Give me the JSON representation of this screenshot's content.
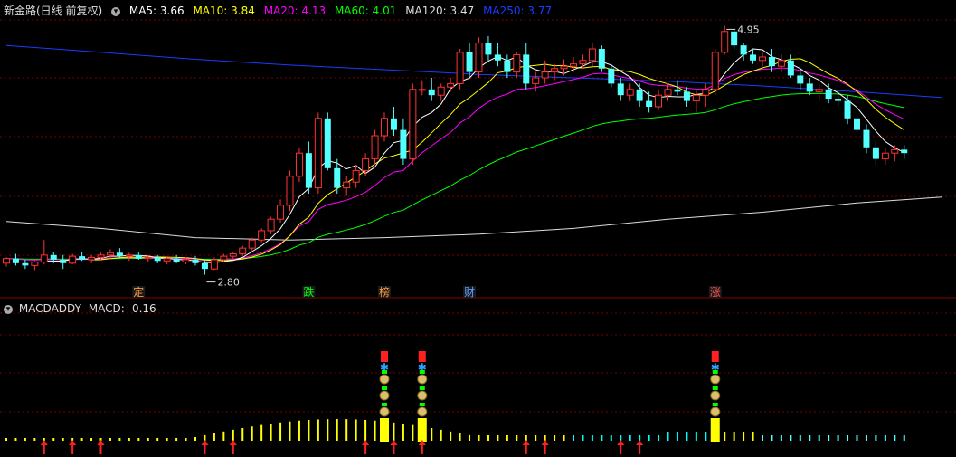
{
  "header": {
    "title": "新金路(日线 前复权)",
    "ma": [
      {
        "label": "MA5: 3.66",
        "color": "#ffffff"
      },
      {
        "label": "MA10: 3.84",
        "color": "#ffff00"
      },
      {
        "label": "MA20: 4.13",
        "color": "#ff00ff"
      },
      {
        "label": "MA60: 4.01",
        "color": "#00ff00"
      },
      {
        "label": "MA120: 3.47",
        "color": "#dddddd"
      },
      {
        "label": "MA250: 3.77",
        "color": "#1a3cff"
      }
    ]
  },
  "indicator": {
    "name": "MACDADDY",
    "value_label": "MACD: -0.16"
  },
  "colors": {
    "up": "#ff3232",
    "down": "#54ffff",
    "grid": "#7a0000",
    "ma5": "#ffffff",
    "ma10": "#ffff00",
    "ma20": "#ff00ff",
    "ma60": "#00ff00",
    "ma120": "#dddddd",
    "ma250": "#1a3cff"
  },
  "chart_data": [
    {
      "type": "candlestick",
      "title": "新金路(日线 前复权)",
      "annotations": [
        {
          "text": "4.95",
          "kind": "high",
          "index": 76
        },
        {
          "text": "2.80",
          "kind": "low",
          "index": 21
        }
      ],
      "event_markers": [
        {
          "text": "定",
          "index": 14,
          "color": "#ff9a3c"
        },
        {
          "text": "跌",
          "index": 32,
          "color": "#00ff00"
        },
        {
          "text": "榜",
          "index": 40,
          "color": "#ff9a3c"
        },
        {
          "text": "财",
          "index": 49,
          "color": "#5a9cff"
        },
        {
          "text": "涨",
          "index": 75,
          "color": "#ff5050"
        }
      ],
      "ohlc": [
        [
          2.9,
          2.95,
          2.87,
          2.94
        ],
        [
          2.94,
          2.98,
          2.88,
          2.9
        ],
        [
          2.9,
          2.93,
          2.85,
          2.88
        ],
        [
          2.88,
          2.92,
          2.84,
          2.91
        ],
        [
          2.91,
          3.1,
          2.89,
          2.97
        ],
        [
          2.97,
          3.0,
          2.9,
          2.93
        ],
        [
          2.93,
          2.97,
          2.85,
          2.9
        ],
        [
          2.9,
          2.98,
          2.89,
          2.96
        ],
        [
          2.96,
          3.0,
          2.92,
          2.93
        ],
        [
          2.93,
          2.97,
          2.9,
          2.95
        ],
        [
          2.95,
          2.99,
          2.93,
          2.97
        ],
        [
          2.97,
          3.02,
          2.94,
          2.99
        ],
        [
          2.99,
          3.03,
          2.95,
          2.96
        ],
        [
          2.96,
          2.99,
          2.92,
          2.97
        ],
        [
          2.97,
          3.0,
          2.93,
          2.94
        ],
        [
          2.94,
          2.97,
          2.91,
          2.95
        ],
        [
          2.95,
          2.97,
          2.9,
          2.92
        ],
        [
          2.92,
          2.96,
          2.89,
          2.94
        ],
        [
          2.94,
          2.97,
          2.9,
          2.91
        ],
        [
          2.91,
          2.95,
          2.89,
          2.93
        ],
        [
          2.93,
          2.96,
          2.88,
          2.9
        ],
        [
          2.9,
          2.92,
          2.8,
          2.85
        ],
        [
          2.85,
          2.95,
          2.84,
          2.93
        ],
        [
          2.93,
          2.98,
          2.91,
          2.96
        ],
        [
          2.96,
          3.0,
          2.94,
          2.98
        ],
        [
          2.98,
          3.05,
          2.96,
          3.03
        ],
        [
          3.03,
          3.12,
          3.01,
          3.1
        ],
        [
          3.1,
          3.2,
          3.08,
          3.18
        ],
        [
          3.18,
          3.3,
          3.15,
          3.28
        ],
        [
          3.28,
          3.45,
          3.25,
          3.4
        ],
        [
          3.4,
          3.7,
          3.35,
          3.65
        ],
        [
          3.65,
          3.9,
          3.6,
          3.85
        ],
        [
          3.85,
          3.95,
          3.5,
          3.55
        ],
        [
          3.55,
          4.2,
          3.5,
          4.15
        ],
        [
          4.15,
          4.2,
          3.7,
          3.72
        ],
        [
          3.72,
          3.8,
          3.5,
          3.55
        ],
        [
          3.55,
          3.65,
          3.48,
          3.6
        ],
        [
          3.6,
          3.75,
          3.55,
          3.7
        ],
        [
          3.7,
          3.85,
          3.65,
          3.8
        ],
        [
          3.8,
          4.05,
          3.75,
          4.0
        ],
        [
          4.0,
          4.2,
          3.95,
          4.15
        ],
        [
          4.15,
          4.25,
          4.0,
          4.05
        ],
        [
          4.05,
          4.15,
          3.75,
          3.8
        ],
        [
          3.8,
          4.45,
          3.75,
          4.4
        ],
        [
          4.4,
          4.48,
          4.35,
          4.4
        ],
        [
          4.4,
          4.5,
          4.3,
          4.35
        ],
        [
          4.35,
          4.45,
          4.3,
          4.42
        ],
        [
          4.42,
          4.5,
          4.38,
          4.45
        ],
        [
          4.45,
          4.75,
          4.4,
          4.72
        ],
        [
          4.72,
          4.8,
          4.5,
          4.55
        ],
        [
          4.55,
          4.85,
          4.5,
          4.8
        ],
        [
          4.8,
          4.86,
          4.65,
          4.7
        ],
        [
          4.7,
          4.8,
          4.6,
          4.65
        ],
        [
          4.65,
          4.7,
          4.5,
          4.55
        ],
        [
          4.55,
          4.72,
          4.5,
          4.7
        ],
        [
          4.7,
          4.8,
          4.4,
          4.45
        ],
        [
          4.45,
          4.55,
          4.38,
          4.5
        ],
        [
          4.5,
          4.65,
          4.45,
          4.55
        ],
        [
          4.55,
          4.62,
          4.48,
          4.58
        ],
        [
          4.58,
          4.66,
          4.52,
          4.6
        ],
        [
          4.6,
          4.68,
          4.55,
          4.62
        ],
        [
          4.62,
          4.7,
          4.58,
          4.65
        ],
        [
          4.65,
          4.8,
          4.6,
          4.75
        ],
        [
          4.75,
          4.78,
          4.55,
          4.58
        ],
        [
          4.58,
          4.62,
          4.42,
          4.45
        ],
        [
          4.45,
          4.5,
          4.3,
          4.35
        ],
        [
          4.35,
          4.45,
          4.3,
          4.4
        ],
        [
          4.4,
          4.45,
          4.25,
          4.3
        ],
        [
          4.3,
          4.38,
          4.2,
          4.25
        ],
        [
          4.25,
          4.4,
          4.22,
          4.35
        ],
        [
          4.35,
          4.45,
          4.3,
          4.4
        ],
        [
          4.4,
          4.48,
          4.35,
          4.38
        ],
        [
          4.38,
          4.42,
          4.25,
          4.3
        ],
        [
          4.3,
          4.4,
          4.2,
          4.35
        ],
        [
          4.35,
          4.45,
          4.25,
          4.4
        ],
        [
          4.4,
          4.75,
          4.35,
          4.72
        ],
        [
          4.72,
          4.95,
          4.7,
          4.9
        ],
        [
          4.9,
          4.92,
          4.75,
          4.78
        ],
        [
          4.78,
          4.8,
          4.65,
          4.7
        ],
        [
          4.7,
          4.75,
          4.62,
          4.65
        ],
        [
          4.65,
          4.72,
          4.6,
          4.68
        ],
        [
          4.68,
          4.75,
          4.55,
          4.6
        ],
        [
          4.6,
          4.7,
          4.55,
          4.65
        ],
        [
          4.65,
          4.7,
          4.5,
          4.52
        ],
        [
          4.52,
          4.58,
          4.4,
          4.45
        ],
        [
          4.45,
          4.5,
          4.35,
          4.38
        ],
        [
          4.38,
          4.45,
          4.3,
          4.4
        ],
        [
          4.4,
          4.45,
          4.28,
          4.32
        ],
        [
          4.32,
          4.4,
          4.25,
          4.3
        ],
        [
          4.3,
          4.35,
          4.1,
          4.15
        ],
        [
          4.15,
          4.25,
          4.0,
          4.05
        ],
        [
          4.05,
          4.1,
          3.85,
          3.9
        ],
        [
          3.9,
          3.95,
          3.75,
          3.8
        ],
        [
          3.8,
          3.9,
          3.75,
          3.85
        ],
        [
          3.85,
          3.92,
          3.78,
          3.88
        ],
        [
          3.88,
          3.92,
          3.8,
          3.85
        ]
      ],
      "ma_lines": [
        {
          "name": "MA120",
          "points": [
            [
              0,
              3.26
            ],
            [
              10,
              3.2
            ],
            [
              20,
              3.12
            ],
            [
              30,
              3.1
            ],
            [
              40,
              3.12
            ],
            [
              50,
              3.15
            ],
            [
              60,
              3.2
            ],
            [
              70,
              3.28
            ],
            [
              80,
              3.34
            ],
            [
              90,
              3.42
            ],
            [
              99,
              3.47
            ]
          ]
        },
        {
          "name": "MA250",
          "points": [
            [
              0,
              4.78
            ],
            [
              10,
              4.72
            ],
            [
              20,
              4.66
            ],
            [
              30,
              4.61
            ],
            [
              40,
              4.57
            ],
            [
              50,
              4.53
            ],
            [
              60,
              4.5
            ],
            [
              70,
              4.47
            ],
            [
              80,
              4.43
            ],
            [
              90,
              4.38
            ],
            [
              99,
              4.33
            ]
          ]
        }
      ]
    },
    {
      "type": "bar",
      "title": "MACDADDY",
      "value_label": "MACD: -0.16",
      "signal_columns": [
        40,
        44,
        75
      ],
      "arrow_indices": [
        4,
        7,
        10,
        21,
        24,
        38,
        41,
        44,
        55,
        57,
        65,
        67
      ]
    }
  ]
}
